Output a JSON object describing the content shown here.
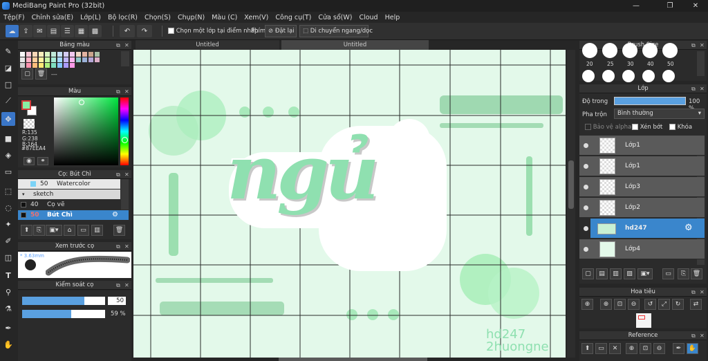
{
  "window": {
    "title": "MediBang Paint Pro (32bit)",
    "minimize": "—",
    "restore": "❐",
    "close": "✕"
  },
  "menu": [
    "Tệp(F)",
    "Chỉnh sửa(E)",
    "Lớp(L)",
    "Bộ lọc(R)",
    "Chọn(S)",
    "Chụp(N)",
    "Màu (C)",
    "Xem(V)",
    "Công cụ(T)",
    "Cửa sổ(W)",
    "Cloud",
    "Help"
  ],
  "toolbar": {
    "select_layer_label": "Chọn một lớp tại điểm nhấp",
    "key_label": "Phím",
    "reset_label": "Đặt lại",
    "move_label": "Di chuyển ngang/dọc"
  },
  "palette": {
    "title": "Bảng màu",
    "placeholder": "---"
  },
  "color": {
    "title": "Màu",
    "r": "R:135",
    "g": "G:238",
    "b": "B:164",
    "hex": "#87EEA4",
    "fg": "#87eea4"
  },
  "brush": {
    "title": "Cọ: Bút Chì",
    "items": [
      {
        "size": "50",
        "name": "Watercolor"
      },
      {
        "size": "",
        "name": "sketch"
      },
      {
        "size": "40",
        "name": "Cọ vẽ"
      },
      {
        "size": "50",
        "name": "Bút Chì"
      }
    ]
  },
  "preview": {
    "title": "Xem trước cọ",
    "size": "3.63mm"
  },
  "brushctl": {
    "title": "Kiểm soát cọ",
    "size_val": "50",
    "opacity_val": "59 %"
  },
  "tabs": {
    "left": "Untitled",
    "right": "Untitled"
  },
  "canvas": {
    "text": "ngủ",
    "watermark1": "hd247",
    "watermark2": "2huongne"
  },
  "brushsize": {
    "title": "Brush Size",
    "labels": [
      "20",
      "25",
      "30",
      "40",
      "50"
    ]
  },
  "layer": {
    "title": "Lớp",
    "opacity_label": "Độ trong",
    "opacity_val": "100 %",
    "blend_label": "Pha trộn",
    "blend_val": "Bình thường",
    "protect_alpha": "Bảo vệ alpha",
    "clip": "Xén bớt",
    "lock": "Khóa",
    "rows": [
      "Lớp1",
      "Lớp1",
      "Lớp3",
      "Lớp2",
      "hd247",
      "Lớp4"
    ]
  },
  "navigator": {
    "title": "Hoa tiêu"
  },
  "reference": {
    "title": "Reference"
  },
  "accent": "#3a86cc"
}
